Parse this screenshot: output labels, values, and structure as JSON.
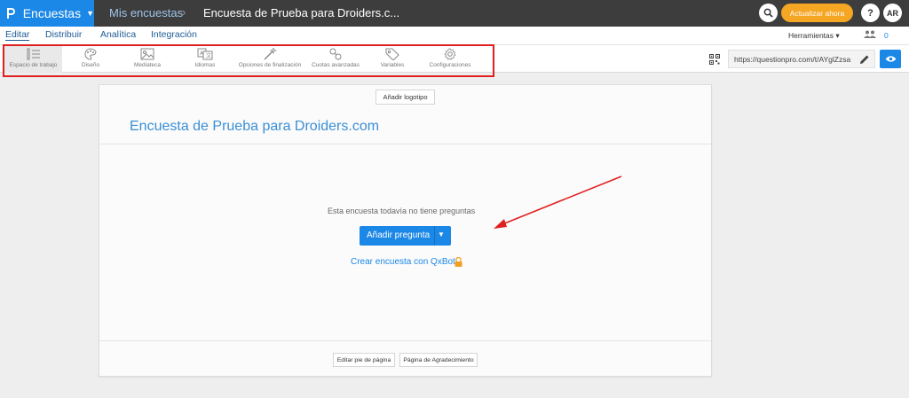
{
  "topbar": {
    "brand_label": "Encuestas",
    "crumb1": "Mis encuestas",
    "crumb_sep": "›",
    "crumb2": "Encuesta de Prueba para Droiders.c...",
    "upgrade_label": "Actualizar ahora",
    "help_label": "?",
    "user_initials": "AR"
  },
  "nav2": {
    "tabs": [
      {
        "label": "Editar"
      },
      {
        "label": "Distribuir"
      },
      {
        "label": "Analítica"
      },
      {
        "label": "Integración"
      }
    ],
    "tools_label": "Herramientas ▾",
    "collab_count": "0"
  },
  "toolbar": {
    "items": [
      {
        "label": "Espacio de trabajo",
        "icon": "workspace-icon"
      },
      {
        "label": "Diseño",
        "icon": "palette-icon"
      },
      {
        "label": "Mediateca",
        "icon": "image-icon"
      },
      {
        "label": "Idiomas",
        "icon": "translate-icon"
      },
      {
        "label": "Opciones de finalización",
        "icon": "magic-wand-icon"
      },
      {
        "label": "Cuotas avanzadas",
        "icon": "link-icon"
      },
      {
        "label": "Variables",
        "icon": "tag-icon"
      },
      {
        "label": "Configuraciones",
        "icon": "gear-icon"
      }
    ],
    "survey_url": "https://questionpro.com/t/AYglZzsa"
  },
  "survey": {
    "add_logo": "Añadir logotipo",
    "title": "Encuesta de Prueba para Droiders.com",
    "empty_message": "Esta encuesta todavía no tiene preguntas",
    "add_question": "Añadir pregunta",
    "qxbot_link": "Crear encuesta con QxBot",
    "footer_button": "Editar pie de página",
    "thanks_button": "Página de Agradecimiento"
  },
  "colors": {
    "brand": "#1b87e6",
    "topbar": "#3d3d3d",
    "upgrade": "#f5a623",
    "annotation": "#e02020"
  }
}
